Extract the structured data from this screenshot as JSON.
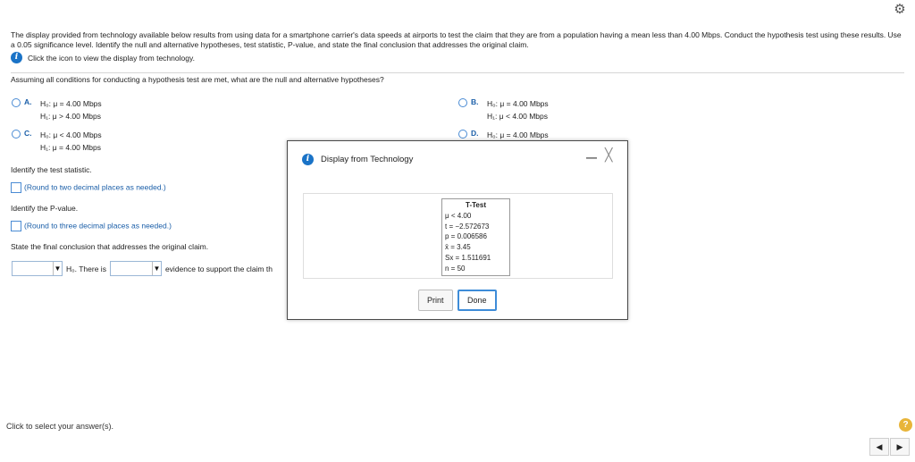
{
  "problem": {
    "text": "The display provided from technology available below results from using data for a smartphone carrier's data speeds at airports to test the claim that they are from a population having a mean less than 4.00 Mbps. Conduct the hypothesis test using these results. Use a 0.05 significance level. Identify the null and alternative hypotheses, test statistic, P-value, and state the final conclusion that addresses the original claim.",
    "hint": "Click the icon to view the display from technology."
  },
  "question": "Assuming all conditions for conducting a hypothesis test are met, what are the null and alternative hypotheses?",
  "options": [
    {
      "letter": "A.",
      "h0": "H₀: μ = 4.00 Mbps",
      "h1": "H₁: μ > 4.00 Mbps"
    },
    {
      "letter": "B.",
      "h0": "H₀: μ = 4.00 Mbps",
      "h1": "H₁: μ < 4.00 Mbps"
    },
    {
      "letter": "C.",
      "h0": "H₀: μ < 4.00 Mbps",
      "h1": "H₁: μ = 4.00 Mbps"
    },
    {
      "letter": "D.",
      "h0": "H₀: μ = 4.00 Mbps",
      "h1": ""
    }
  ],
  "test_statistic": {
    "label": "Identify the test statistic.",
    "note": "(Round to two decimal places as needed.)"
  },
  "p_value": {
    "label": "Identify the P-value.",
    "note": "(Round to three decimal places as needed.)"
  },
  "conclusion": {
    "label": "State the final conclusion that addresses the original claim.",
    "h0_text": "H₀. There is",
    "evidence_text": "evidence to support the claim th"
  },
  "dialog": {
    "title": "Display from Technology",
    "minimize": "—",
    "close": "╳",
    "ttest_title": "T-Test",
    "ttest_lines": [
      "μ < 4.00",
      "t = −2.572673",
      "p = 0.006586",
      "x̄ = 3.45",
      "Sx = 1.511691",
      "n = 50"
    ],
    "print_label": "Print",
    "done_label": "Done"
  },
  "footer": {
    "text": "Click to select your answer(s).",
    "help": "?",
    "prev": "◀",
    "next": "▶"
  },
  "icons": {
    "gear": "⚙",
    "info": "i",
    "dropdown": "▼"
  }
}
